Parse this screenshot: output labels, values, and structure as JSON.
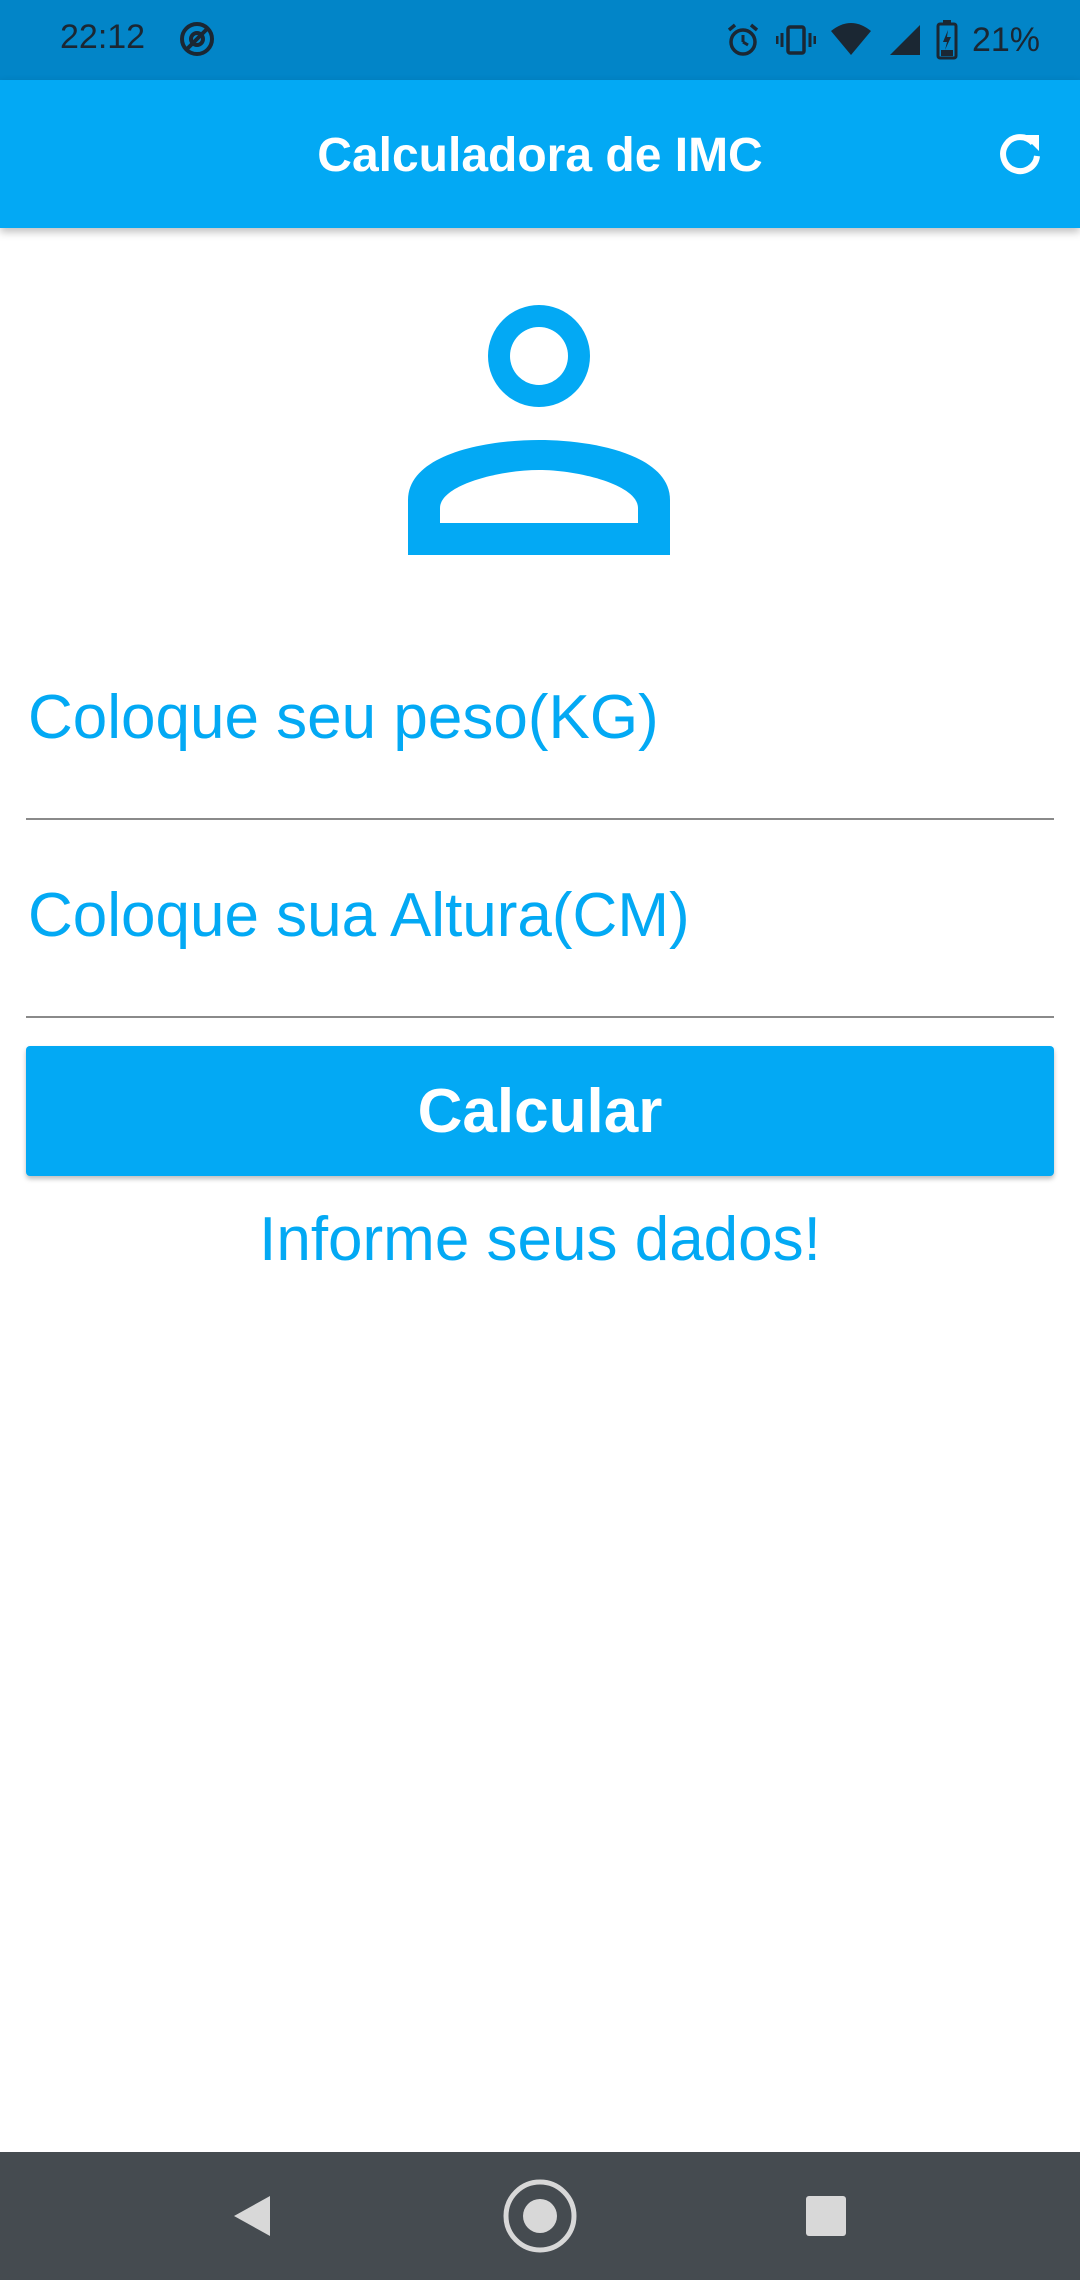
{
  "status_bar": {
    "time": "22:12",
    "battery_percent": "21%",
    "icons": [
      "vpn-circle-icon",
      "alarm-icon",
      "vibrate-icon",
      "wifi-icon",
      "cell-signal-icon",
      "battery-charging-icon"
    ]
  },
  "app_bar": {
    "title": "Calculadora de IMC",
    "refresh_icon": "refresh-icon"
  },
  "form": {
    "avatar_icon": "person-outline-icon",
    "weight_label": "Coloque seu peso(KG)",
    "height_label": "Coloque sua Altura(CM)",
    "calculate_label": "Calcular",
    "info_text": "Informe seus dados!"
  },
  "nav_bar": {
    "icons": [
      "back-icon",
      "home-icon",
      "recents-icon"
    ]
  },
  "colors": {
    "status_bar": "#0285c8",
    "app_bar": "#03a9f4",
    "accent": "#03a9f4",
    "nav_bar": "#454b50"
  }
}
